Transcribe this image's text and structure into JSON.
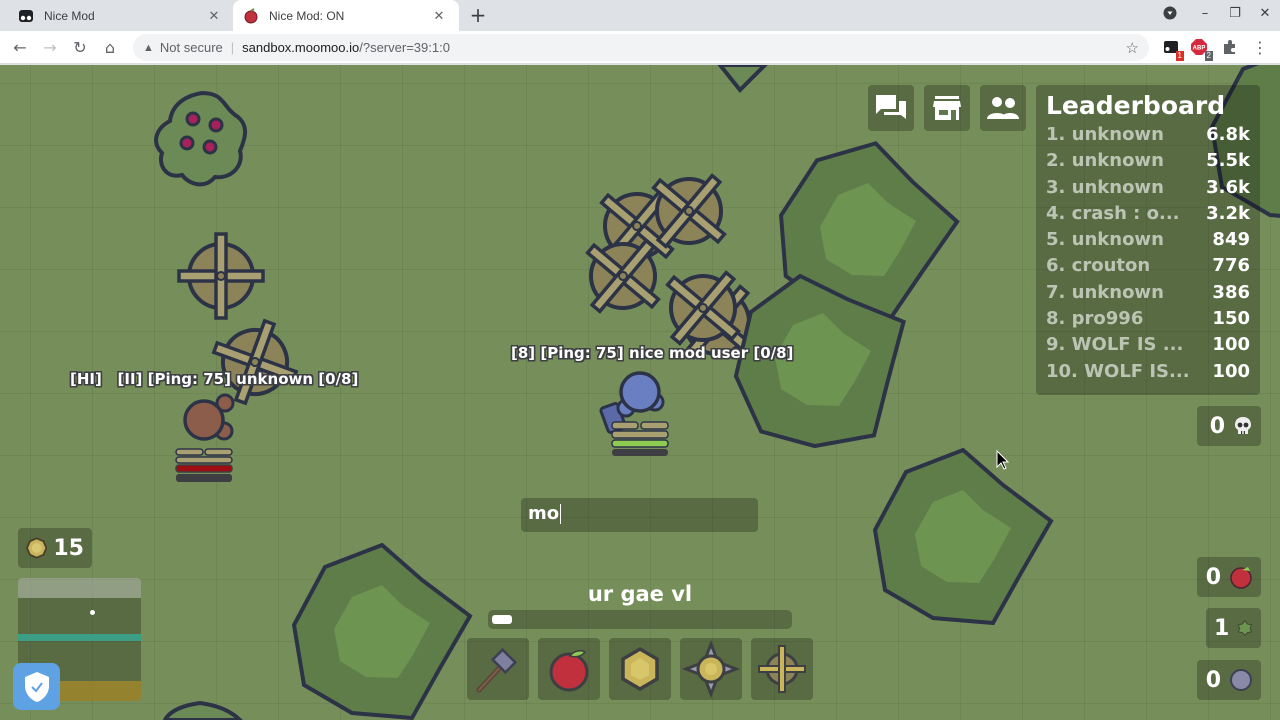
{
  "browser": {
    "tabs": [
      {
        "title": "Nice Mod",
        "active": false,
        "icon": "mask-icon"
      },
      {
        "title": "Nice Mod: ON",
        "active": true,
        "icon": "apple-icon"
      }
    ],
    "new_tab_label": "+",
    "url_security": "Not secure",
    "url_host": "sandbox.moomoo.io",
    "url_path": "/?server=39:1:0",
    "extensions": [
      {
        "name": "mod-extension-icon",
        "badge": "1",
        "badge_color": "#d93025"
      },
      {
        "name": "adblock-icon",
        "label": "ABP",
        "badge": "2",
        "badge_color": "#5f6368"
      },
      {
        "name": "extensions-puzzle-icon"
      }
    ]
  },
  "game": {
    "hud_buttons": [
      {
        "name": "chat-button",
        "icon": "chat-icon"
      },
      {
        "name": "shop-button",
        "icon": "store-icon"
      },
      {
        "name": "clan-button",
        "icon": "people-icon"
      }
    ],
    "leaderboard": {
      "title": "Leaderboard",
      "entries": [
        {
          "rank": "1.",
          "name": "unknown",
          "score": "6.8k"
        },
        {
          "rank": "2.",
          "name": "unknown",
          "score": "5.5k"
        },
        {
          "rank": "3.",
          "name": "unknown",
          "score": "3.6k"
        },
        {
          "rank": "4.",
          "name": "crash : o...",
          "score": "3.2k"
        },
        {
          "rank": "5.",
          "name": "unknown",
          "score": "849"
        },
        {
          "rank": "6.",
          "name": "crouton",
          "score": "776"
        },
        {
          "rank": "7.",
          "name": "unknown",
          "score": "386"
        },
        {
          "rank": "8.",
          "name": "pro996",
          "score": "150"
        },
        {
          "rank": "9.",
          "name": "WOLF IS ...",
          "score": "100"
        },
        {
          "rank": "10.",
          "name": "WOLF IS...",
          "score": "100"
        }
      ]
    },
    "kills": {
      "value": "0",
      "icon": "skull-icon"
    },
    "resources": {
      "gold": {
        "value": "15",
        "icon": "gold-coin-icon"
      },
      "food": {
        "value": "0",
        "icon": "food-apple-icon"
      },
      "wood": {
        "value": "1",
        "icon": "wood-bush-icon"
      },
      "stone": {
        "value": "0",
        "icon": "stone-icon"
      }
    },
    "players": [
      {
        "tag": "[8] [Ping: 75] nice mod user [0/8]",
        "is_self": true
      },
      {
        "tag": "[HI]   [II] [Ping: 75] unknown [0/8]",
        "is_self": false
      }
    ],
    "chat_input": {
      "value": "mo"
    },
    "age": {
      "label": "ur gae vl",
      "progress": 0.05
    },
    "action_bar": [
      {
        "name": "hammer-slot",
        "icon": "hammer-icon"
      },
      {
        "name": "apple-slot",
        "icon": "apple-icon"
      },
      {
        "name": "wall-slot",
        "icon": "wood-wall-icon"
      },
      {
        "name": "spike-slot",
        "icon": "spike-icon"
      },
      {
        "name": "windmill-slot",
        "icon": "windmill-icon"
      }
    ],
    "colors": {
      "grass": "#768f5a",
      "tree_outer": "#5b7a45",
      "tree_inner": "#6d9150",
      "outline": "#2d3347",
      "self_skin": "#6a7fc2",
      "enemy_skin": "#8c5d4a",
      "windmill": "#8c8358",
      "hp_green": "#8ecc51",
      "hp_red": "#9d0d12"
    }
  }
}
